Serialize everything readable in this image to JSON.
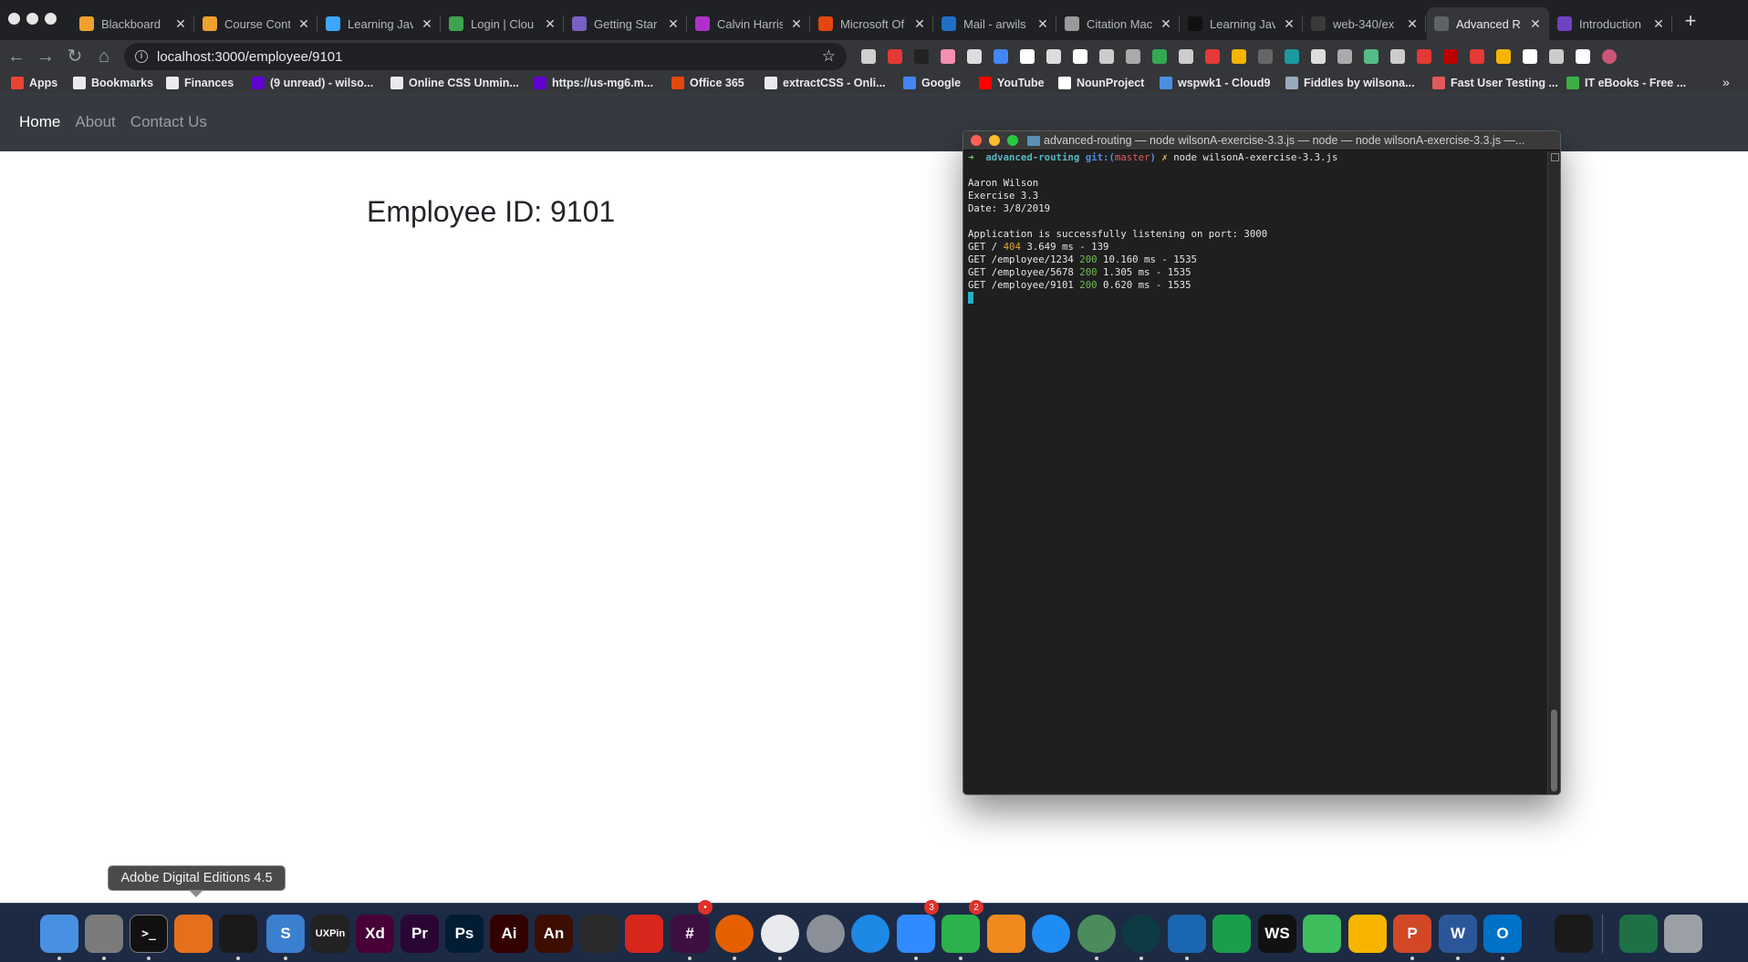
{
  "browser": {
    "tabs": [
      {
        "title": "Blackboard",
        "icon": "pencil-square-icon",
        "color": "#f0a030"
      },
      {
        "title": "Course Cont",
        "icon": "pencil-square-icon",
        "color": "#f0a030"
      },
      {
        "title": "Learning Jav",
        "icon": "play-triangle-icon",
        "color": "#3ea6ff"
      },
      {
        "title": "Login | Clou",
        "icon": "leaf-icon",
        "color": "#3fa34d"
      },
      {
        "title": "Getting Star",
        "icon": "k-square-icon",
        "color": "#7a5fc4"
      },
      {
        "title": "Calvin Harris",
        "icon": "diamond-icon",
        "color": "#b02fc9"
      },
      {
        "title": "Microsoft Of",
        "icon": "office-icon",
        "color": "#e3460f"
      },
      {
        "title": "Mail - arwils",
        "icon": "outlook-icon",
        "color": "#1f6fc7"
      },
      {
        "title": "Citation Mac",
        "icon": "citation-icon",
        "color": "#9a9a9a"
      },
      {
        "title": "Learning Jav",
        "icon": "medium-icon",
        "color": "#111111"
      },
      {
        "title": "web-340/ex",
        "icon": "github-icon",
        "color": "#3a3a3a"
      },
      {
        "title": "Advanced R",
        "icon": "page-icon",
        "color": "#5f6368",
        "active": true
      },
      {
        "title": "Introduction",
        "icon": "bootstrap-icon",
        "color": "#6f42c1"
      }
    ],
    "tab_close_glyph": "✕",
    "url": "localhost:3000/employee/9101"
  },
  "bookmarks": [
    {
      "label": "Apps",
      "icon": "apps-grid-icon",
      "color": "#ea4335"
    },
    {
      "label": "Bookmarks",
      "icon": "star-icon",
      "color": "#e8eaed"
    },
    {
      "label": "Finances",
      "icon": "folder-icon",
      "color": "#e8eaed"
    },
    {
      "label": "(9 unread) - wilso...",
      "icon": "yahoo-icon",
      "color": "#6001d2"
    },
    {
      "label": "Online CSS Unmin...",
      "icon": "c-icon",
      "color": "#e8eaed"
    },
    {
      "label": "https://us-mg6.m...",
      "icon": "yahoo-icon",
      "color": "#6001d2"
    },
    {
      "label": "Office 365",
      "icon": "office-icon",
      "color": "#e3460f"
    },
    {
      "label": "extractCSS - Onli...",
      "icon": "page-icon",
      "color": "#e8eaed"
    },
    {
      "label": "Google",
      "icon": "google-icon",
      "color": "#4285f4"
    },
    {
      "label": "YouTube",
      "icon": "youtube-icon",
      "color": "#ff0000"
    },
    {
      "label": "NounProject",
      "icon": "noun-project-icon",
      "color": "#ffffff"
    },
    {
      "label": "wspwk1 - Cloud9",
      "icon": "cloud9-icon",
      "color": "#4a90e2"
    },
    {
      "label": "Fiddles by wilsona...",
      "icon": "jsfiddle-icon",
      "color": "#9ab"
    },
    {
      "label": "Fast User Testing ...",
      "icon": "testing-icon",
      "color": "#e25a5a"
    },
    {
      "label": "IT eBooks - Free ...",
      "icon": "green-dot-icon",
      "color": "#3cb043"
    }
  ],
  "site": {
    "nav": [
      {
        "label": "Home",
        "active": true
      },
      {
        "label": "About",
        "active": false
      },
      {
        "label": "Contact Us",
        "active": false
      }
    ],
    "heading": "Employee ID: 9101"
  },
  "terminal": {
    "title": "advanced-routing — node wilsonA-exercise-3.3.js — node — node wilsonA-exercise-3.3.js —...",
    "prompt": {
      "arrow": "➜",
      "dir": "advanced-routing",
      "git_label": "git:(",
      "branch": "master",
      "git_close": ")",
      "dirty": "✗",
      "command": "node wilsonA-exercise-3.3.js"
    },
    "header_lines": [
      "Aaron Wilson",
      "Exercise 3.3",
      "Date: 3/8/2019"
    ],
    "listening": "Application is successfully listening on port: 3000",
    "requests": [
      {
        "method": "GET",
        "path": "/",
        "status": "404",
        "time": "3.649 ms",
        "size": "139"
      },
      {
        "method": "GET",
        "path": "/employee/1234",
        "status": "200",
        "time": "10.160 ms",
        "size": "1535"
      },
      {
        "method": "GET",
        "path": "/employee/5678",
        "status": "200",
        "time": "1.305 ms",
        "size": "1535"
      },
      {
        "method": "GET",
        "path": "/employee/9101",
        "status": "200",
        "time": "0.620 ms",
        "size": "1535"
      }
    ]
  },
  "tooltip": "Adobe Digital Editions 4.5",
  "dock": [
    {
      "name": "finder-icon",
      "label": "",
      "bg": "#4a90e2",
      "running": true
    },
    {
      "name": "system-preferences-icon",
      "label": "",
      "bg": "#7b7b7b",
      "running": true
    },
    {
      "name": "terminal-icon",
      "label": ">_",
      "bg": "#111111",
      "running": true
    },
    {
      "name": "books-icon",
      "label": "",
      "bg": "#e4701e",
      "running": false
    },
    {
      "name": "adobe-digital-editions-icon",
      "label": "",
      "bg": "#1a1a1a",
      "running": true
    },
    {
      "name": "snagit-icon",
      "label": "S",
      "bg": "#3b7fd0",
      "running": true
    },
    {
      "name": "uxpin-icon",
      "label": "UXPin",
      "bg": "#222222",
      "running": false
    },
    {
      "name": "adobe-xd-icon",
      "label": "Xd",
      "bg": "#470137",
      "running": false
    },
    {
      "name": "premiere-icon",
      "label": "Pr",
      "bg": "#2a0634",
      "running": false
    },
    {
      "name": "photoshop-icon",
      "label": "Ps",
      "bg": "#001d34",
      "running": false
    },
    {
      "name": "illustrator-icon",
      "label": "Ai",
      "bg": "#330000",
      "running": false
    },
    {
      "name": "animate-icon",
      "label": "An",
      "bg": "#3c0d00",
      "running": false
    },
    {
      "name": "acrobat-icon",
      "label": "",
      "bg": "#2a2a2a",
      "running": false
    },
    {
      "name": "acrobat-reader-icon",
      "label": "",
      "bg": "#d7261c",
      "running": false
    },
    {
      "name": "slack-icon",
      "label": "#",
      "bg": "#3f0e40",
      "running": true,
      "badge": "•"
    },
    {
      "name": "firefox-icon",
      "label": "",
      "bg": "#e66000",
      "running": true
    },
    {
      "name": "chrome-icon",
      "label": "",
      "bg": "#e8eaed",
      "running": true
    },
    {
      "name": "launchpad-icon",
      "label": "",
      "bg": "#8a8f98",
      "running": false
    },
    {
      "name": "safari-icon",
      "label": "",
      "bg": "#1e88e5",
      "running": false
    },
    {
      "name": "messages-icon",
      "label": "",
      "bg": "#2f8bff",
      "running": true,
      "badge": "3"
    },
    {
      "name": "facetime-icon",
      "label": "",
      "bg": "#2bb24c",
      "running": true,
      "badge": "2"
    },
    {
      "name": "ibooks-icon",
      "label": "",
      "bg": "#f08a1c",
      "running": false
    },
    {
      "name": "app-store-icon",
      "label": "",
      "bg": "#1f8cf3",
      "running": false
    },
    {
      "name": "atom-icon",
      "label": "",
      "bg": "#4c8c5c",
      "running": true
    },
    {
      "name": "gitkraken-icon",
      "label": "",
      "bg": "#0e3b43",
      "running": true
    },
    {
      "name": "vscode-icon",
      "label": "",
      "bg": "#1a66b0",
      "running": true
    },
    {
      "name": "vscode-insiders-icon",
      "label": "",
      "bg": "#1a9e4a",
      "running": false
    },
    {
      "name": "webstorm-icon",
      "label": "WS",
      "bg": "#111111",
      "running": false
    },
    {
      "name": "sourcetree-icon",
      "label": "",
      "bg": "#3dbd5c",
      "running": false
    },
    {
      "name": "sketch-icon",
      "label": "",
      "bg": "#f7b500",
      "running": false
    },
    {
      "name": "powerpoint-icon",
      "label": "P",
      "bg": "#d24726",
      "running": true
    },
    {
      "name": "word-icon",
      "label": "W",
      "bg": "#2b579a",
      "running": true
    },
    {
      "name": "outlook-icon",
      "label": "O",
      "bg": "#0072c6",
      "running": true
    },
    {
      "name": "activity-monitor-icon",
      "label": "",
      "bg": "#1a1a1a",
      "running": false
    },
    {
      "name": "excel-file-icon",
      "label": "",
      "bg": "#1e7145",
      "running": false
    },
    {
      "name": "trash-icon",
      "label": "",
      "bg": "#9aa0a6",
      "running": false
    }
  ]
}
